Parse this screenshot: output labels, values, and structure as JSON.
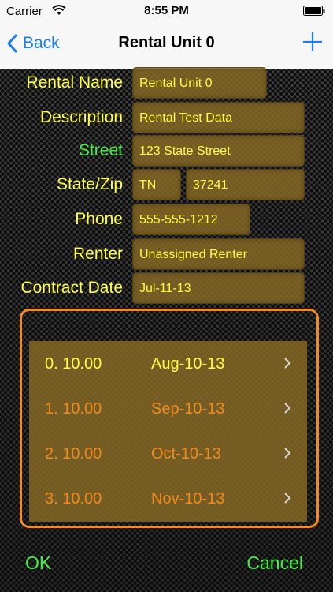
{
  "status_bar": {
    "carrier": "Carrier",
    "time": "8:55 PM"
  },
  "nav": {
    "back_label": "Back",
    "title": "Rental Unit 0",
    "accent": "#1a7ef7"
  },
  "form": {
    "rental_name": {
      "label": "Rental Name",
      "value": "Rental Unit 0"
    },
    "description": {
      "label": "Description",
      "value": "Rental Test Data"
    },
    "street": {
      "label": "Street",
      "value": "123 State Street"
    },
    "state_zip": {
      "label": "State/Zip",
      "state": "TN",
      "zip": "37241"
    },
    "phone": {
      "label": "Phone",
      "value": "555-555-1212"
    },
    "renter": {
      "label": "Renter",
      "value": "Unassigned Renter"
    },
    "contract_date": {
      "label": "Contract Date",
      "value": "Jul-11-13"
    }
  },
  "schedule": [
    {
      "amount": "0. 10.00",
      "date": "Aug-10-13",
      "selected": true
    },
    {
      "amount": "1. 10.00",
      "date": "Sep-10-13",
      "selected": false
    },
    {
      "amount": "2. 10.00",
      "date": "Oct-10-13",
      "selected": false
    },
    {
      "amount": "3. 10.00",
      "date": "Nov-10-13",
      "selected": false
    }
  ],
  "actions": {
    "ok_label": "OK",
    "cancel_label": "Cancel"
  },
  "colors": {
    "label_yellow": "#ffff45",
    "label_green": "#43f143",
    "row_orange": "#f28a1e",
    "field_bg": "#846824"
  },
  "icons": [
    "wifi-icon",
    "battery-icon",
    "chevron-left-icon",
    "plus-icon",
    "chevron-right-icon"
  ]
}
